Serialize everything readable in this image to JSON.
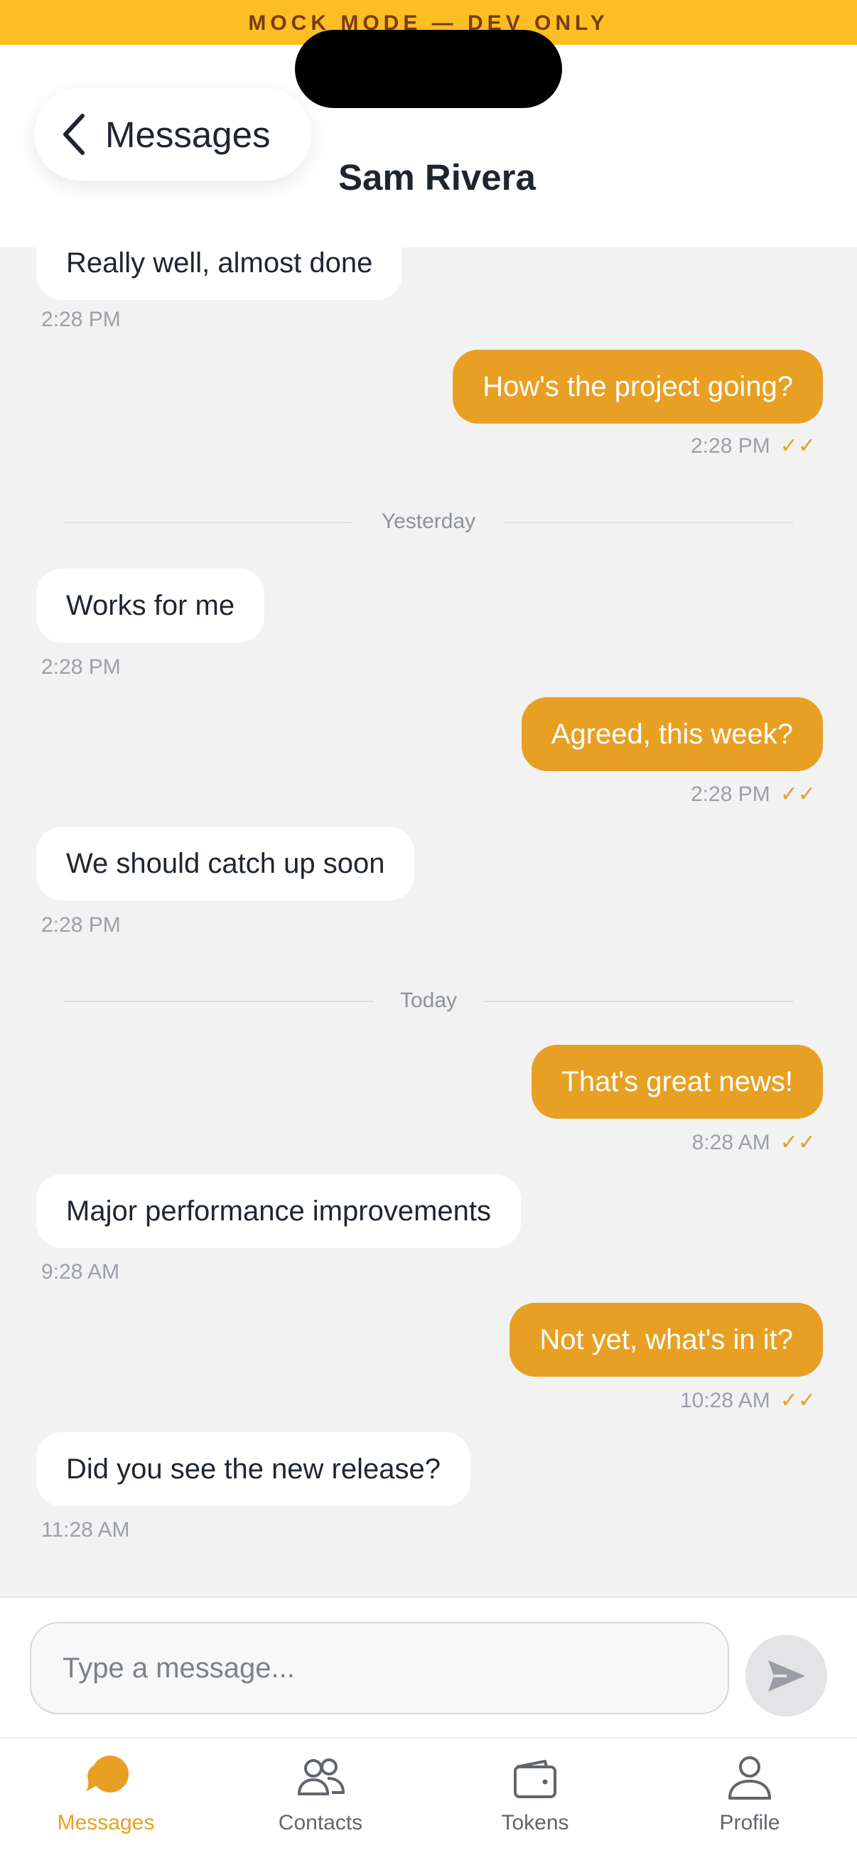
{
  "dev_banner": "MOCK MODE — DEV ONLY",
  "header": {
    "back_label": "Messages",
    "contact_name": "Sam Rivera"
  },
  "messages": [
    {
      "direction": "in",
      "text": "Really well, almost done",
      "time": "2:28 PM"
    },
    {
      "direction": "out",
      "text": "How's the project going?",
      "time": "2:28 PM",
      "status": "✓✓"
    },
    {
      "divider": "Yesterday"
    },
    {
      "direction": "in",
      "text": "Works for me",
      "time": "2:28 PM"
    },
    {
      "direction": "out",
      "text": "Agreed, this week?",
      "time": "2:28 PM",
      "status": "✓✓"
    },
    {
      "direction": "in",
      "text": "We should catch up soon",
      "time": "2:28 PM"
    },
    {
      "divider": "Today"
    },
    {
      "direction": "out",
      "text": "That's great news!",
      "time": "8:28 AM",
      "status": "✓✓"
    },
    {
      "direction": "in",
      "text": "Major performance improvements",
      "time": "9:28 AM"
    },
    {
      "direction": "out",
      "text": "Not yet, what's in it?",
      "time": "10:28 AM",
      "status": "✓✓"
    },
    {
      "direction": "in",
      "text": "Did you see the new release?",
      "time": "11:28 AM"
    }
  ],
  "composer": {
    "placeholder": "Type a message...",
    "value": "",
    "send_icon": "send-icon"
  },
  "tabs": [
    {
      "label": "Messages",
      "icon": "chat-bubble-icon",
      "active": true
    },
    {
      "label": "Contacts",
      "icon": "people-icon",
      "active": false
    },
    {
      "label": "Tokens",
      "icon": "wallet-icon",
      "active": false
    },
    {
      "label": "Profile",
      "icon": "person-icon",
      "active": false
    }
  ],
  "colors": {
    "accent": "#e8a024",
    "banner": "#fbbf24",
    "background": "#f2f2f3"
  }
}
